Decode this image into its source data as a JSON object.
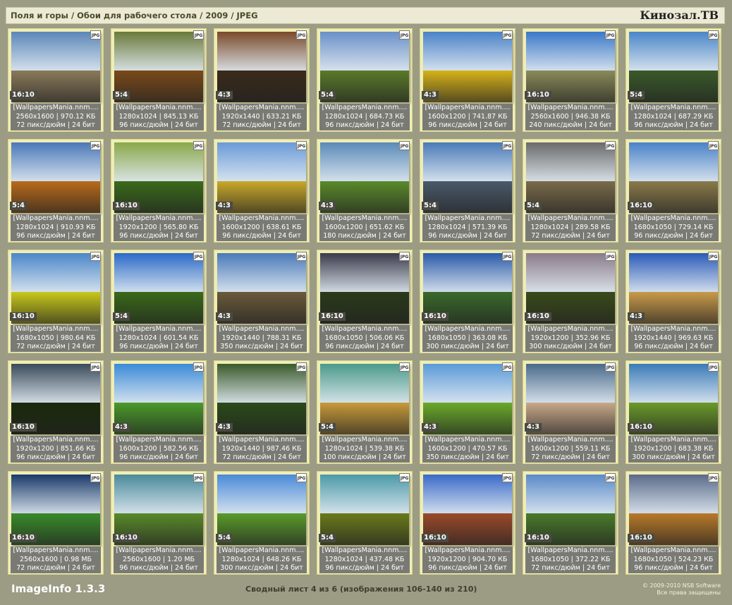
{
  "header": {
    "breadcrumb": "Поля и горы / Обои для рабочего стола / 2009 / JPEG",
    "brand": "Кинозал.ТВ"
  },
  "footer": {
    "app_name": "ImageInfo 1.3.3",
    "sheet_info": "Сводный лист 4 из 6 (изображения 106-140 из 210)",
    "copyright": "© 2009-2010 NSB Software",
    "rights": "Все права защищены"
  },
  "thumbnails": [
    {
      "badge": "JPG",
      "ratio": "16:10",
      "name": "[WallpapersMania.nnm....",
      "dims": "2560x1600 | 970.12 КБ",
      "meta": "72 пикс/дюйм | 24 бит",
      "sky": "#5b86b8",
      "ground": "#8a7a5a"
    },
    {
      "badge": "JPG",
      "ratio": "5:4",
      "name": "[WallpapersMania.nnm....",
      "dims": "1280x1024 | 845.13 КБ",
      "meta": "96 пикс/дюйм | 24 бит",
      "sky": "#6a7a3a",
      "ground": "#7a4a1a"
    },
    {
      "badge": "JPG",
      "ratio": "4:3",
      "name": "[WallpapersMania.nnm....",
      "dims": "1920x1440 | 633.21 КБ",
      "meta": "72 пикс/дюйм | 24 бит",
      "sky": "#7a4a2a",
      "ground": "#3a2a1a"
    },
    {
      "badge": "JPG",
      "ratio": "5:4",
      "name": "[WallpapersMania.nnm....",
      "dims": "1280x1024 | 684.73 КБ",
      "meta": "96 пикс/дюйм | 24 бит",
      "sky": "#6a90c8",
      "ground": "#5a7a2a"
    },
    {
      "badge": "JPG",
      "ratio": "4:3",
      "name": "[WallpapersMania.nnm....",
      "dims": "1600x1200 | 741.87 КБ",
      "meta": "96 пикс/дюйм | 24 бит",
      "sky": "#4a82c8",
      "ground": "#d6b21a"
    },
    {
      "badge": "JPG",
      "ratio": "16:10",
      "name": "[WallpapersMania.nnm....",
      "dims": "2560x1600 | 946.38 КБ",
      "meta": "240 пикс/дюйм | 24 бит",
      "sky": "#3a78c8",
      "ground": "#8a8a5a"
    },
    {
      "badge": "JPG",
      "ratio": "5:4",
      "name": "[WallpapersMania.nnm....",
      "dims": "1280x1024 | 687.29 КБ",
      "meta": "96 пикс/дюйм | 24 бит",
      "sky": "#4a86c8",
      "ground": "#3a5a2a"
    },
    {
      "badge": "JPG",
      "ratio": "5:4",
      "name": "[WallpapersMania.nnm....",
      "dims": "1280x1024 | 910.93 КБ",
      "meta": "96 пикс/дюйм | 24 бит",
      "sky": "#4a78b8",
      "ground": "#b86a1a"
    },
    {
      "badge": "JPG",
      "ratio": "16:10",
      "name": "[WallpapersMania.nnm....",
      "dims": "1920x1200 | 565.80 КБ",
      "meta": "96 пикс/дюйм | 24 бит",
      "sky": "#8aa84a",
      "ground": "#3a6a1a"
    },
    {
      "badge": "JPG",
      "ratio": "4:3",
      "name": "[WallpapersMania.nnm....",
      "dims": "1600x1200 | 638.61 КБ",
      "meta": "96 пикс/дюйм | 24 бит",
      "sky": "#6a9ad8",
      "ground": "#c8a82a"
    },
    {
      "badge": "JPG",
      "ratio": "4:3",
      "name": "[WallpapersMania.nnm....",
      "dims": "1600x1200 | 651.62 КБ",
      "meta": "180 пикс/дюйм | 24 бит",
      "sky": "#5a8ab8",
      "ground": "#5a8a2a"
    },
    {
      "badge": "JPG",
      "ratio": "5:4",
      "name": "[WallpapersMania.nnm....",
      "dims": "1280x1024 | 571.39 КБ",
      "meta": "96 пикс/дюйм | 24 бит",
      "sky": "#4a7ab8",
      "ground": "#4a5a6a"
    },
    {
      "badge": "JPG",
      "ratio": "5:4",
      "name": "[WallpapersMania.nnm....",
      "dims": "1280x1024 | 289.58 КБ",
      "meta": "72 пикс/дюйм | 24 бит",
      "sky": "#6a6a6a",
      "ground": "#7a6a4a"
    },
    {
      "badge": "JPG",
      "ratio": "16:10",
      "name": "[WallpapersMania.nnm....",
      "dims": "1680x1050 | 729.14 КБ",
      "meta": "96 пикс/дюйм | 24 бит",
      "sky": "#4a82c8",
      "ground": "#8a7a4a"
    },
    {
      "badge": "JPG",
      "ratio": "16:10",
      "name": "[WallpapersMania.nnm....",
      "dims": "1680x1050 | 980.64 КБ",
      "meta": "72 пикс/дюйм | 24 бит",
      "sky": "#4a86c8",
      "ground": "#c8c81a"
    },
    {
      "badge": "JPG",
      "ratio": "5:4",
      "name": "[WallpapersMania.nnm....",
      "dims": "1280x1024 | 601.54 КБ",
      "meta": "96 пикс/дюйм | 24 бит",
      "sky": "#2a6ac8",
      "ground": "#3a6a1a"
    },
    {
      "badge": "JPG",
      "ratio": "4:3",
      "name": "[WallpapersMania.nnm....",
      "dims": "1920x1440 | 788.31 КБ",
      "meta": "350 пикс/дюйм | 24 бит",
      "sky": "#4a7ab8",
      "ground": "#6a5a3a"
    },
    {
      "badge": "JPG",
      "ratio": "16:10",
      "name": "[WallpapersMania.nnm....",
      "dims": "1680x1050 | 506.06 КБ",
      "meta": "96 пикс/дюйм | 24 бит",
      "sky": "#3a3a4a",
      "ground": "#2a3a1a"
    },
    {
      "badge": "JPG",
      "ratio": "16:10",
      "name": "[WallpapersMania.nnm....",
      "dims": "1680x1050 | 363.08 КБ",
      "meta": "300 пикс/дюйм | 24 бит",
      "sky": "#2a5aa8",
      "ground": "#3a6a2a"
    },
    {
      "badge": "JPG",
      "ratio": "16:10",
      "name": "[WallpapersMania.nnm....",
      "dims": "1920x1200 | 352.96 КБ",
      "meta": "300 пикс/дюйм | 24 бит",
      "sky": "#8a7a8a",
      "ground": "#3a4a1a"
    },
    {
      "badge": "JPG",
      "ratio": "4:3",
      "name": "[WallpapersMania.nnm....",
      "dims": "1920x1440 | 969.63 КБ",
      "meta": "96 пикс/дюйм | 24 бит",
      "sky": "#2a5ab8",
      "ground": "#c89a4a"
    },
    {
      "badge": "JPG",
      "ratio": "16:10",
      "name": "[WallpapersMania.nnm....",
      "dims": "1920x1200 | 851.66 КБ",
      "meta": "96 пикс/дюйм | 24 бит",
      "sky": "#3a4a5a",
      "ground": "#1a2a0a"
    },
    {
      "badge": "JPG",
      "ratio": "4:3",
      "name": "[WallpapersMania.nnm....",
      "dims": "1600x1200 | 582.56 КБ",
      "meta": "96 пикс/дюйм | 24 бит",
      "sky": "#3a8ad8",
      "ground": "#4a9a2a"
    },
    {
      "badge": "JPG",
      "ratio": "4:3",
      "name": "[WallpapersMania.nnm....",
      "dims": "1920x1440 | 987.46 КБ",
      "meta": "72 пикс/дюйм | 24 бит",
      "sky": "#3a5a2a",
      "ground": "#2a4a1a"
    },
    {
      "badge": "JPG",
      "ratio": "5:4",
      "name": "[WallpapersMania.nnm....",
      "dims": "1280x1024 | 539.38 КБ",
      "meta": "100 пикс/дюйм | 24 бит",
      "sky": "#4a9a8a",
      "ground": "#c89a3a"
    },
    {
      "badge": "JPG",
      "ratio": "4:3",
      "name": "[WallpapersMania.nnm....",
      "dims": "1600x1200 | 470.57 КБ",
      "meta": "350 пикс/дюйм | 24 бит",
      "sky": "#5a9ad8",
      "ground": "#6aaa2a"
    },
    {
      "badge": "JPG",
      "ratio": "4:3",
      "name": "[WallpapersMania.nnm....",
      "dims": "1600x1200 | 559.11 КБ",
      "meta": "72 пикс/дюйм | 24 бит",
      "sky": "#4a6a8a",
      "ground": "#c8a88a"
    },
    {
      "badge": "JPG",
      "ratio": "16:10",
      "name": "[WallpapersMania.nnm....",
      "dims": "1920x1200 | 683.38 КБ",
      "meta": "300 пикс/дюйм | 24 бит",
      "sky": "#3a7ab8",
      "ground": "#6a9a2a"
    },
    {
      "badge": "JPG",
      "ratio": "16:10",
      "name": "[WallpapersMania.nnm....",
      "dims": "2560x1600 | 0.98 МБ",
      "meta": "72 пикс/дюйм | 24 бит",
      "sky": "#1a3a6a",
      "ground": "#3a8a2a"
    },
    {
      "badge": "JPG",
      "ratio": "16:10",
      "name": "[WallpapersMania.nnm....",
      "dims": "2560x1600 | 1.20 МБ",
      "meta": "96 пикс/дюйм | 24 бит",
      "sky": "#4a8a9a",
      "ground": "#5a8a2a"
    },
    {
      "badge": "JPG",
      "ratio": "5:4",
      "name": "[WallpapersMania.nnm....",
      "dims": "1280x1024 | 648.26 КБ",
      "meta": "300 пикс/дюйм | 24 бит",
      "sky": "#4a8ad8",
      "ground": "#5a9a2a"
    },
    {
      "badge": "JPG",
      "ratio": "5:4",
      "name": "[WallpapersMania.nnm....",
      "dims": "1280x1024 | 437.48 КБ",
      "meta": "96 пикс/дюйм | 24 бит",
      "sky": "#4a9aa8",
      "ground": "#6a7a1a"
    },
    {
      "badge": "JPG",
      "ratio": "16:10",
      "name": "[WallpapersMania.nnm....",
      "dims": "1920x1200 | 904.70 КБ",
      "meta": "96 пикс/дюйм | 24 бит",
      "sky": "#3a6ac8",
      "ground": "#9a4a2a"
    },
    {
      "badge": "JPG",
      "ratio": "16:10",
      "name": "[WallpapersMania.nnm....",
      "dims": "1680x1050 | 372.22 КБ",
      "meta": "72 пикс/дюйм | 24 бит",
      "sky": "#5a8ac8",
      "ground": "#4a7a2a"
    },
    {
      "badge": "JPG",
      "ratio": "16:10",
      "name": "[WallpapersMania.nnm....",
      "dims": "1680x1050 | 524.23 КБ",
      "meta": "96 пикс/дюйм | 24 бит",
      "sky": "#5a6a8a",
      "ground": "#b87a2a"
    }
  ]
}
